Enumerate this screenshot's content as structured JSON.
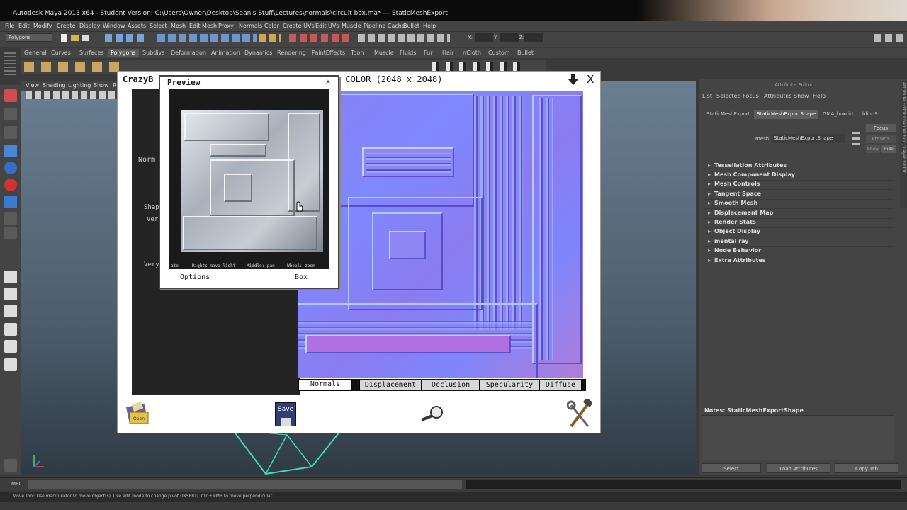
{
  "title_bar": {
    "text": "Autodesk Maya 2013 x64 - Student Version: C:\\Users\\Owner\\Desktop\\Sean's Stuff\\Lectures\\normals\\circuit box.ma*   ---   StaticMeshExport",
    "minimize": "_",
    "close": "×"
  },
  "menu": [
    "File",
    "Edit",
    "Modify",
    "Create",
    "Display",
    "Window",
    "Assets",
    "Select",
    "Mesh",
    "Edit Mesh",
    "Proxy",
    "Normals",
    "Color",
    "Create UVs",
    "Edit UVs",
    "Muscle",
    "Pipeline Cache",
    "Bullet",
    "Help"
  ],
  "mode_select": "Polygons",
  "status_fields": [
    "X:",
    "Y:",
    "Z:"
  ],
  "shelf_tabs": [
    "General",
    "Curves",
    "Surfaces",
    "Polygons",
    "Subdivs",
    "Deformation",
    "Animation",
    "Dynamics",
    "Rendering",
    "PaintEffects",
    "Toon",
    "Muscle",
    "Fluids",
    "Fur",
    "Hair",
    "nCloth",
    "Custom",
    "Bullet"
  ],
  "shelf_active": "Polygons",
  "viewport_menu": [
    "View",
    "Shading",
    "Lighting",
    "Show",
    "R"
  ],
  "attribute_editor": {
    "title": "Attribute Editor",
    "menu": [
      "List",
      "Selected",
      "Focus",
      "Attributes",
      "Show",
      "Help"
    ],
    "tabs": [
      "StaticMeshExport",
      "StaticMeshExportShape",
      "GMA_boxcirt",
      "blinn9"
    ],
    "active_tab": "StaticMeshExportShape",
    "mesh_label": "mesh:",
    "mesh_value": "StaticMeshExportShape",
    "focus_btn": "Focus",
    "presets_btn": "Presets",
    "show_btn": "Show",
    "hide_btn": "Hide",
    "sections": [
      "Tessellation Attributes",
      "Mesh Component Display",
      "Mesh Controls",
      "Tangent Space",
      "Smooth Mesh",
      "Displacement Map",
      "Render Stats",
      "Object Display",
      "mental ray",
      "Node Behavior",
      "Extra Attributes"
    ],
    "notes": "Notes:  StaticMeshExportShape",
    "buttons": [
      "Select",
      "Load Attributes",
      "Copy Tab"
    ],
    "side_tabs": "Attribute Editor    Channel Box / Layer Editor"
  },
  "command_line": {
    "label": "MEL"
  },
  "help_line": "Move Tool: Use manipulator to move object(s). Use edit mode to change pivot (INSERT). Ctrl+MMB to move perpendicular.",
  "crazybump": {
    "app_name": "CrazyB",
    "map_title": "_COLOR (2048 x 2048)",
    "left_labels": [
      "Norm",
      "Shap",
      "Ver",
      "Very"
    ],
    "tabs": [
      "Normals",
      "Displacement",
      "Occlusion",
      "Specularity",
      "Diffuse"
    ],
    "active_tab": "Normals",
    "save_label": "Save",
    "open_label": "Open",
    "close": "X",
    "preview": {
      "title": "Preview",
      "close": "x",
      "hints": [
        "ate",
        "Rights move light",
        "Middle: pan",
        "Wheel: zoom"
      ],
      "options": "Options",
      "shape": "Box"
    }
  }
}
